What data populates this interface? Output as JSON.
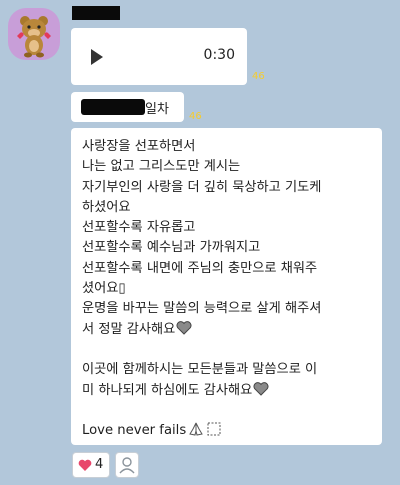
{
  "sender": {
    "avatar_icon": "bear-character-icon"
  },
  "voice_message": {
    "duration": "0:30",
    "read_count": "46",
    "play_icon": "play-icon"
  },
  "day_message": {
    "label": "일차",
    "read_count": "46"
  },
  "text_message": {
    "lines": [
      "사랑장을 선포하면서",
      "나는 없고 그리스도만 계시는",
      "자기부인의 사랑을 더 깊히 묵상하고 기도케",
      "하셨어요",
      "선포할수록 자유롭고",
      "선포할수록 예수님과 가까워지고",
      "선포할수록 내면에 주님의 충만으로 채워주",
      "셨어요▯",
      "운명을 바꾸는 말씀의 능력으로 살게 해주셔",
      "서 정말 감사해요",
      "",
      "이곳에 함께하시는 모든분들과 말씀으로 이",
      "미 하나되게 하심에도 감사해요",
      "",
      "Love never fails"
    ]
  },
  "reactions": {
    "heart_count": "4",
    "heart_color": "#e8466b"
  },
  "colors": {
    "background": "#b2c7da",
    "read_count": "#f5cc2e",
    "avatar_bg": "#c89ed8"
  }
}
